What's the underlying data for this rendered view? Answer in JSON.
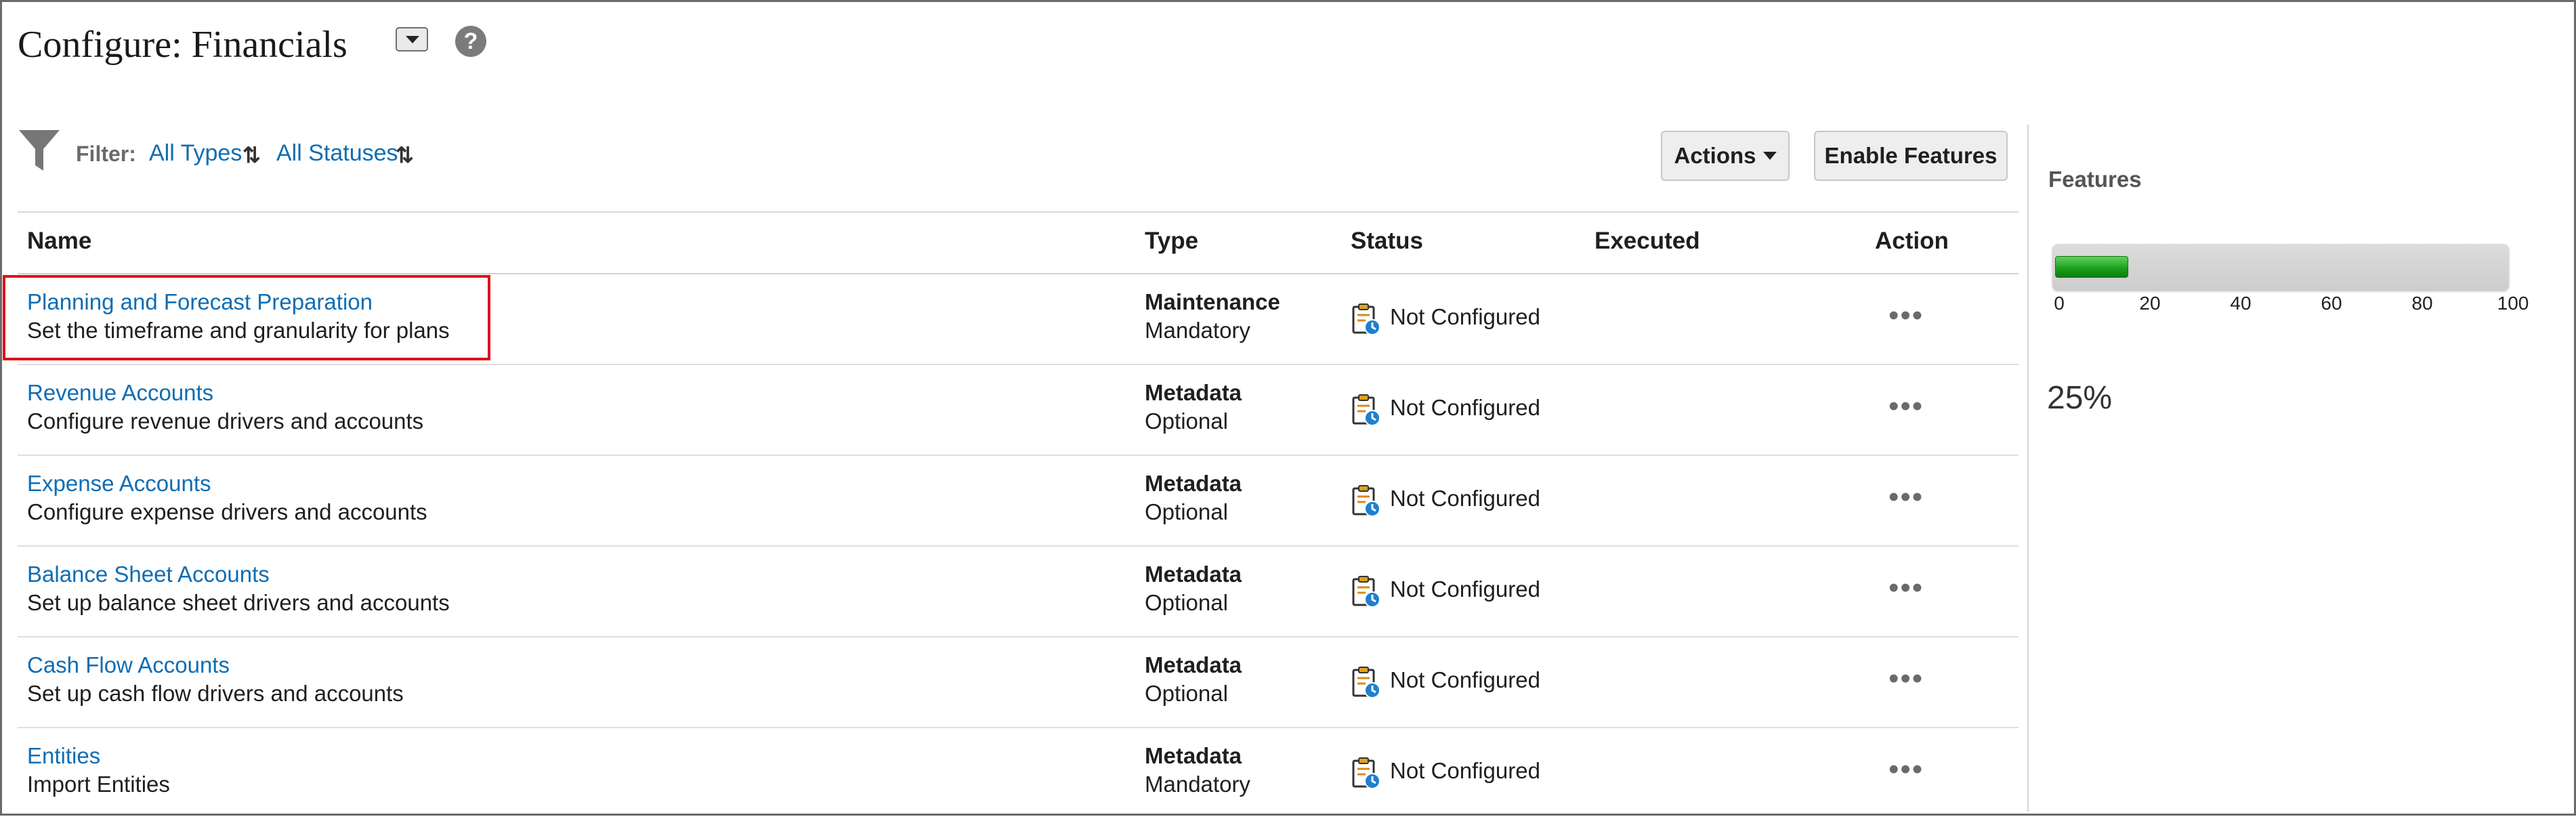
{
  "header": {
    "title": "Configure: Financials",
    "help_symbol": "?"
  },
  "filter": {
    "label": "Filter:",
    "types": "All Types",
    "statuses": "All Statuses",
    "sort_symbol": "⇅"
  },
  "toolbar": {
    "actions_label": "Actions",
    "enable_features_label": "Enable Features"
  },
  "table": {
    "columns": {
      "name": "Name",
      "type": "Type",
      "status": "Status",
      "executed": "Executed",
      "action": "Action"
    },
    "rows": [
      {
        "name": "Planning and Forecast Preparation",
        "description": "Set the timeframe and granularity for plans",
        "type": "Maintenance",
        "requirement": "Mandatory",
        "status": "Not Configured",
        "executed": "",
        "action": "•••"
      },
      {
        "name": "Revenue Accounts",
        "description": "Configure revenue drivers and accounts",
        "type": "Metadata",
        "requirement": "Optional",
        "status": "Not Configured",
        "executed": "",
        "action": "•••"
      },
      {
        "name": "Expense Accounts",
        "description": "Configure expense drivers and accounts",
        "type": "Metadata",
        "requirement": "Optional",
        "status": "Not Configured",
        "executed": "",
        "action": "•••"
      },
      {
        "name": "Balance Sheet Accounts",
        "description": "Set up balance sheet drivers and accounts",
        "type": "Metadata",
        "requirement": "Optional",
        "status": "Not Configured",
        "executed": "",
        "action": "•••"
      },
      {
        "name": "Cash Flow Accounts",
        "description": "Set up cash flow drivers and accounts",
        "type": "Metadata",
        "requirement": "Optional",
        "status": "Not Configured",
        "executed": "",
        "action": "•••"
      },
      {
        "name": "Entities",
        "description": "Import Entities",
        "type": "Metadata",
        "requirement": "Mandatory",
        "status": "Not Configured",
        "executed": "",
        "action": "•••"
      }
    ]
  },
  "features": {
    "title": "Features",
    "progress": 25,
    "scale_max": 100,
    "ticks": [
      "0",
      "20",
      "40",
      "60",
      "80",
      "100"
    ],
    "percent_label": "25%"
  },
  "colors": {
    "link": "#0f6db3",
    "highlight": "#e0101a",
    "progress": "#1b9b1b"
  },
  "icons": {
    "filter": "funnel-icon",
    "status": "clipboard-clock-icon",
    "row_action": "ellipsis-icon"
  }
}
